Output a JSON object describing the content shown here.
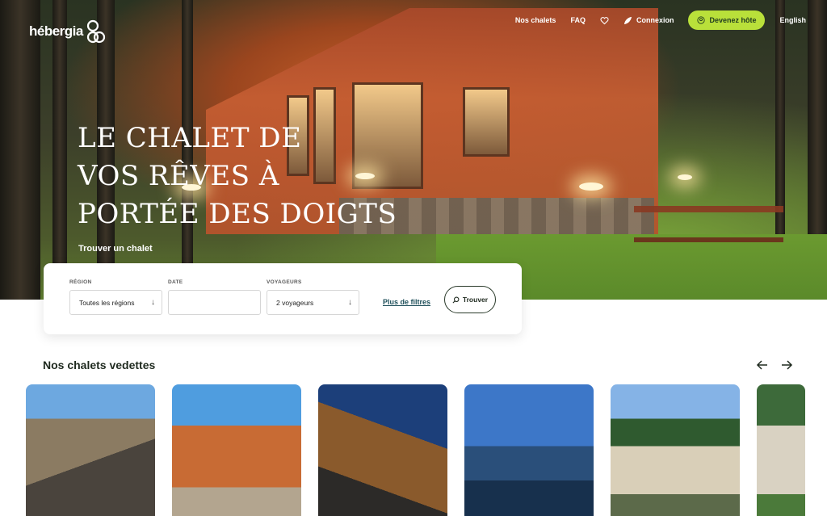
{
  "brand": {
    "name": "hébergia",
    "accent": "#b9e03a"
  },
  "nav": {
    "items": [
      "Nos chalets",
      "FAQ"
    ],
    "favorites_icon": "heart-icon",
    "login_label": "Connexion",
    "host_label": "Devenez hôte",
    "language_label": "English"
  },
  "hero": {
    "headline_line1": "LE CHALET DE",
    "headline_line2": "VOS RÊVES À",
    "headline_line3": "PORTÉE DES DOIGTS",
    "find_label": "Trouver un chalet"
  },
  "search": {
    "region_label": "RÉGION",
    "region_value": "Toutes les régions",
    "date_label": "DATE",
    "date_value": "",
    "travelers_label": "VOYAGEURS",
    "travelers_value": "2 voyageurs",
    "more_filters": "Plus de filtres",
    "find_button": "Trouver"
  },
  "featured": {
    "title": "Nos chalets vedettes",
    "prev_icon": "arrow-left-icon",
    "next_icon": "arrow-right-icon"
  }
}
